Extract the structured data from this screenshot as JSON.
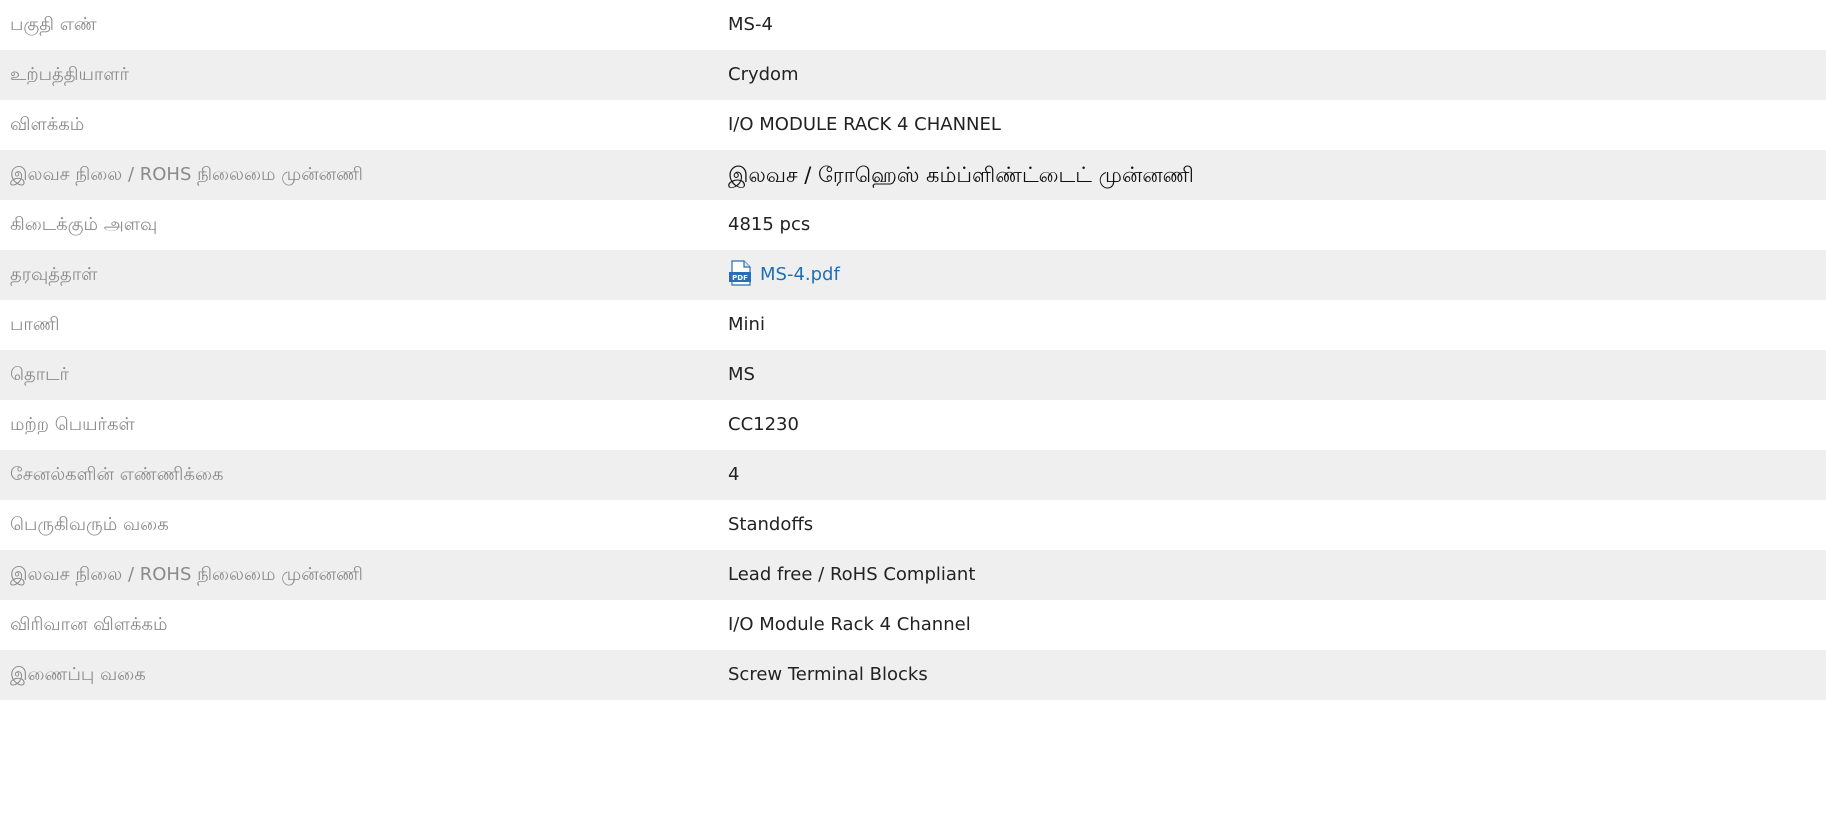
{
  "rows": [
    {
      "label": "பகுதி எண்",
      "value": "MS-4"
    },
    {
      "label": "உற்பத்தியாளர்",
      "value": "Crydom"
    },
    {
      "label": "விளக்கம்",
      "value": "I/O MODULE RACK 4 CHANNEL"
    },
    {
      "label": "இலவச நிலை / ROHS நிலைமை முன்னணி",
      "value": "இலவச / ரோஹெஸ் கம்ப்ளிண்ட்டைட் முன்னணி"
    },
    {
      "label": "கிடைக்கும் அளவு",
      "value": "4815 pcs"
    },
    {
      "label": "தரவுத்தாள்",
      "value": "MS-4.pdf",
      "icon": "pdf-file-icon"
    },
    {
      "label": "பாணி",
      "value": "Mini"
    },
    {
      "label": "தொடர்",
      "value": "MS"
    },
    {
      "label": "மற்ற பெயர்கள்",
      "value": "CC1230"
    },
    {
      "label": "சேனல்களின் எண்ணிக்கை",
      "value": "4"
    },
    {
      "label": "பெருகிவரும் வகை",
      "value": "Standoffs"
    },
    {
      "label": "இலவச நிலை / ROHS நிலைமை முன்னணி",
      "value": "Lead free / RoHS Compliant"
    },
    {
      "label": "விரிவான விளக்கம்",
      "value": "I/O Module Rack 4 Channel"
    },
    {
      "label": "இணைப்பு வகை",
      "value": "Screw Terminal Blocks"
    }
  ],
  "colors": {
    "row_shade": "#efefef",
    "label_text": "#8a8a8a",
    "value_text": "#222222",
    "link": "#1f6fb8"
  }
}
